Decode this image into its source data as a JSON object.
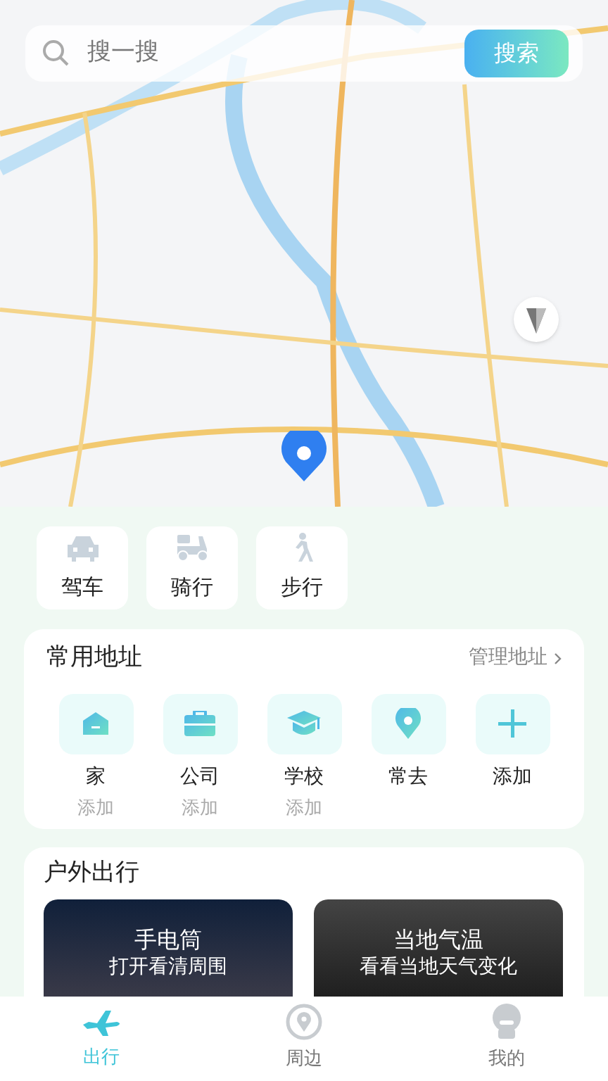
{
  "search": {
    "placeholder": "搜一搜",
    "button": "搜索"
  },
  "travel_modes": [
    {
      "label": "驾车",
      "kind": "car"
    },
    {
      "label": "骑行",
      "kind": "scooter"
    },
    {
      "label": "步行",
      "kind": "walk"
    }
  ],
  "common_addresses": {
    "title": "常用地址",
    "manage_link": "管理地址",
    "items": [
      {
        "label": "家",
        "hint": "添加",
        "kind": "home"
      },
      {
        "label": "公司",
        "hint": "添加",
        "kind": "work"
      },
      {
        "label": "学校",
        "hint": "添加",
        "kind": "school"
      },
      {
        "label": "常去",
        "kind": "place"
      },
      {
        "label": "添加",
        "kind": "add"
      }
    ]
  },
  "outdoor": {
    "title": "户外出行",
    "cards": [
      {
        "title": "手电筒",
        "subtitle": "打开看清周围",
        "kind": "night"
      },
      {
        "title": "当地气温",
        "subtitle": "看看当地天气变化",
        "kind": "rain"
      }
    ]
  },
  "tab_bar": [
    {
      "label": "出行",
      "kind": "plane",
      "selected": true
    },
    {
      "label": "周边",
      "kind": "nearby",
      "selected": false
    },
    {
      "label": "我的",
      "kind": "user",
      "selected": false
    }
  ]
}
